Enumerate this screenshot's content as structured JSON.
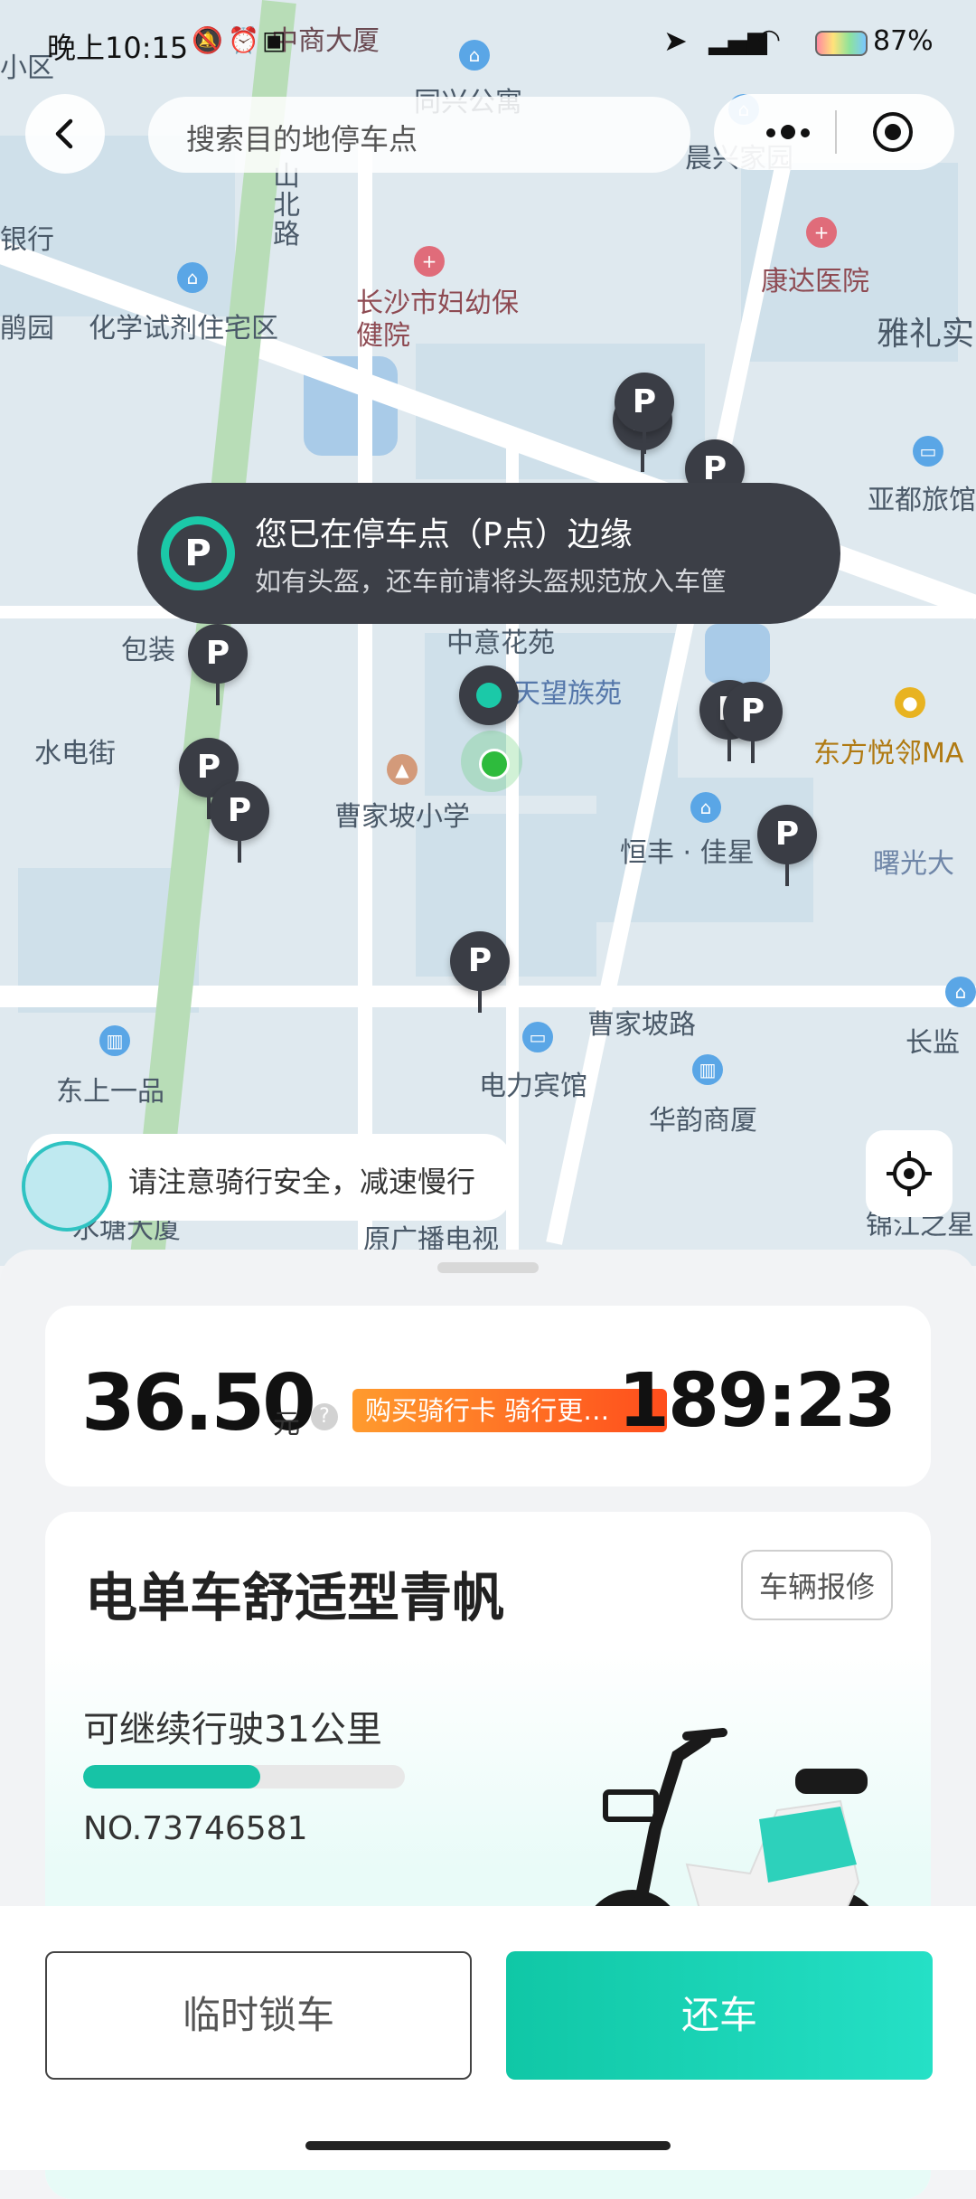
{
  "status_bar": {
    "time": "晚上10:15",
    "battery": "87%"
  },
  "search": {
    "placeholder": "搜索目的地停车点"
  },
  "map": {
    "labels": {
      "shopping": "中商大厦",
      "tongxing": "同兴公寓",
      "chenxing": "晨兴家园",
      "shanbei": "山北路",
      "kangda": "康达医院",
      "yali": "雅礼实",
      "fuyou": "长沙市妇幼保健院",
      "huaxue": "化学试剂住宅区",
      "yadu": "亚都旅馆",
      "baozhuang": "包装",
      "zhongyi": "中意花苑",
      "tianwang": "天望族苑",
      "dongfang": "东方悦邻MA",
      "shuidian": "水电街",
      "caojia_school": "曹家坡小学",
      "hengfeng": "恒丰 · 佳星",
      "shuguang": "曙光大",
      "caojia_road": "曹家坡路",
      "changlan": "长监",
      "dongshang": "东上一品",
      "dianli": "电力宾馆",
      "huayun": "华韵商厦",
      "guangbo": "原广播电视",
      "jinjiang": "锦江之星",
      "shuitang": "水塘大厦",
      "xiaoqu": "小区",
      "hang": "银行",
      "yuan": "鹃园"
    },
    "pin_label": "P"
  },
  "toast": {
    "badge": "P",
    "title": "您已在停车点（P点）边缘",
    "subtitle": "如有头盔，还车前请将头盔规范放入车筐"
  },
  "tip": {
    "text": "请注意骑行安全，减速慢行"
  },
  "fare": {
    "amount": "36.50",
    "unit": "元",
    "help": "?",
    "promo": "购买骑行卡 骑行更…",
    "duration": "189:23"
  },
  "bike": {
    "name": "电单车舒适型青帆",
    "repair": "车辆报修",
    "range": "可继续行驶31公里",
    "battery_fraction": 0.55,
    "serial": "NO.73746581"
  },
  "actions": {
    "temp_lock": "临时锁车",
    "return": "还车"
  }
}
